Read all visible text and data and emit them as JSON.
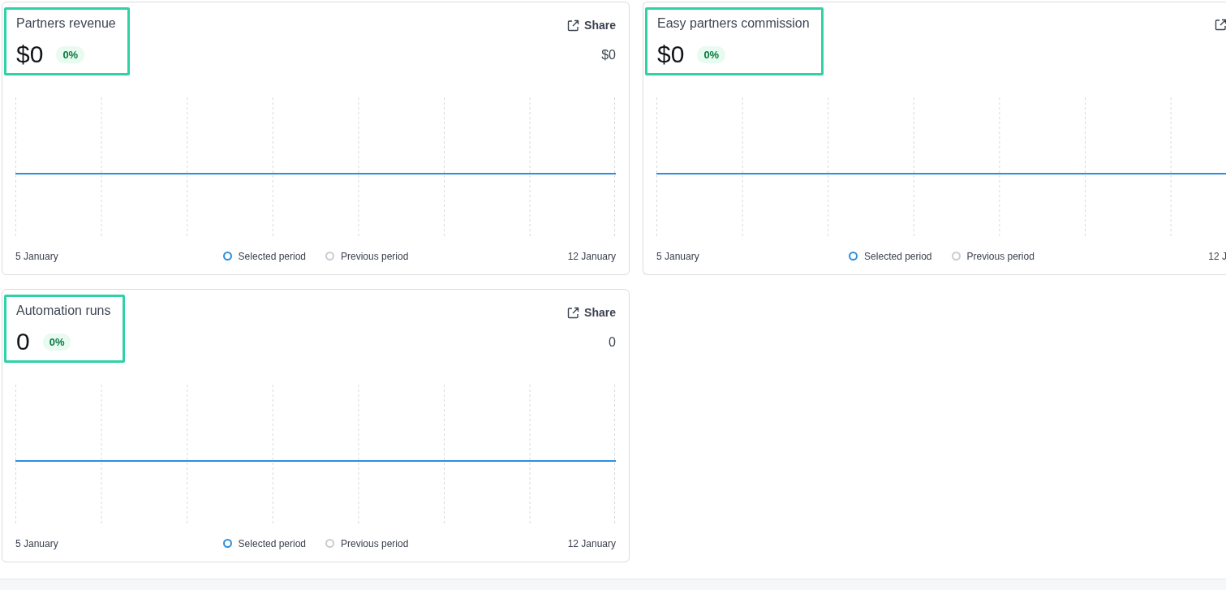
{
  "cards": [
    {
      "title": "Partners revenue",
      "value": "$0",
      "change": "0%",
      "highlighted": true,
      "share_label": "Share",
      "side_value": "$0",
      "x_start": "5 January",
      "x_end": "12 January",
      "legend": [
        {
          "label": "Selected period",
          "color": "#2b8fe0"
        },
        {
          "label": "Previous period",
          "color": "#c9ccd2"
        }
      ]
    },
    {
      "title": "Easy partners commission",
      "value": "$0",
      "change": "0%",
      "highlighted": true,
      "x_start": "5 January",
      "x_end": "12 J",
      "legend": [
        {
          "label": "Selected period",
          "color": "#2b8fe0"
        },
        {
          "label": "Previous period",
          "color": "#c9ccd2"
        }
      ]
    },
    {
      "title": "Automation runs",
      "value": "0",
      "change": "0%",
      "highlighted": true,
      "share_label": "Share",
      "side_value": "0",
      "x_start": "5 January",
      "x_end": "12 January",
      "legend": [
        {
          "label": "Selected period",
          "color": "#2b8fe0"
        },
        {
          "label": "Previous period",
          "color": "#c9ccd2"
        }
      ]
    }
  ]
}
